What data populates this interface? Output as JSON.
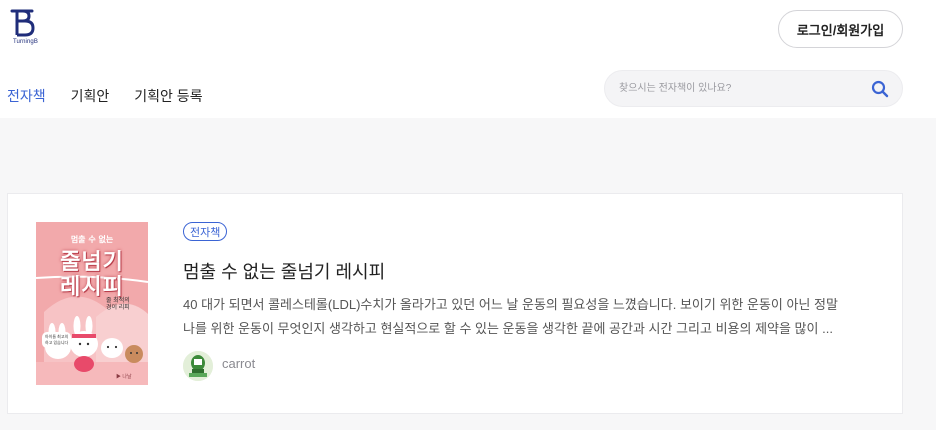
{
  "header": {
    "logo_text": "TurningB",
    "login_label": "로그인/회원가입"
  },
  "nav": {
    "items": [
      {
        "label": "전자책",
        "active": true
      },
      {
        "label": "기획안",
        "active": false
      },
      {
        "label": "기획안 등록",
        "active": false
      }
    ]
  },
  "search": {
    "placeholder": "찾으시는 전자책이 있나요?",
    "value": "",
    "icon": "search-icon"
  },
  "card": {
    "cover": {
      "line1": "멈출 수 없는",
      "line2": "줄넘기",
      "line3": "레시피",
      "sub": "줄 최적의\n경이 리피",
      "small": "아이들 최고의 \n하고 있습니다",
      "brand": "▶ 나날"
    },
    "tag": "전자책",
    "title": "멈출 수 없는 줄넘기 레시피",
    "description_lines": [
      "40 대가 되면서 콜레스테롤(LDL)수치가 올라가고 있던 어느 날 운동의 필요성을 느꼈습니다. 보이기 위한 운동이 아닌 정말",
      "나를 위한 운동이 무엇인지 생각하고 현실적으로 할 수 있는 운동을 생각한 끝에 공간과 시간 그리고 비용의 제약을 많이 ..."
    ],
    "author": "carrot"
  },
  "colors": {
    "accent": "#3b64d4",
    "logo": "#1f2d7a",
    "cover_bg": "#f2a9ab"
  }
}
